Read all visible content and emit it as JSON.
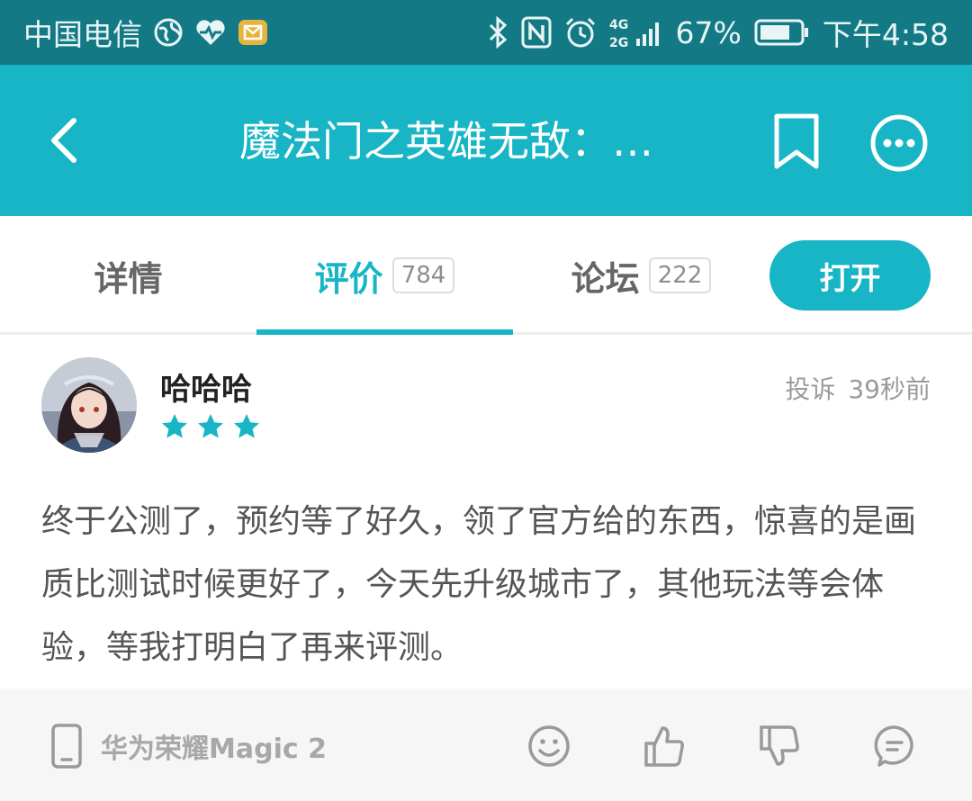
{
  "status_bar": {
    "carrier": "中国电信",
    "network_4g": "4G",
    "network_2g": "2G",
    "battery_percent": "67%",
    "time": "下午4:58",
    "icons": [
      "globe-icon",
      "heart-pulse-icon",
      "mail-app-icon",
      "bluetooth-icon",
      "nfc-icon",
      "alarm-icon",
      "signal-icon",
      "battery-icon"
    ]
  },
  "app_bar": {
    "title": "魔法门之英雄无敌：…",
    "back_icon": "back-icon",
    "bookmark_icon": "bookmark-icon",
    "more_icon": "more-icon",
    "background_color": "#17b5c5"
  },
  "tabs": [
    {
      "label": "详情",
      "count": ""
    },
    {
      "label": "评价",
      "count": "784",
      "active": true
    },
    {
      "label": "论坛",
      "count": "222"
    }
  ],
  "open_button": {
    "label": "打开"
  },
  "review": {
    "username": "哈哈哈",
    "rating": 3,
    "report_label": "投诉",
    "time_ago": "39秒前",
    "content": "终于公测了，预约等了好久，领了官方给的东西，惊喜的是画质比测试时候更好了，今天先升级城市了，其他玩法等会体验，等我打明白了再来评测。",
    "device": "华为荣耀Magic 2",
    "actions": [
      "smile-icon",
      "thumbs-up-icon",
      "thumbs-down-icon",
      "comment-icon"
    ]
  },
  "colors": {
    "accent": "#17b5c5",
    "status_bar": "#137a85"
  }
}
